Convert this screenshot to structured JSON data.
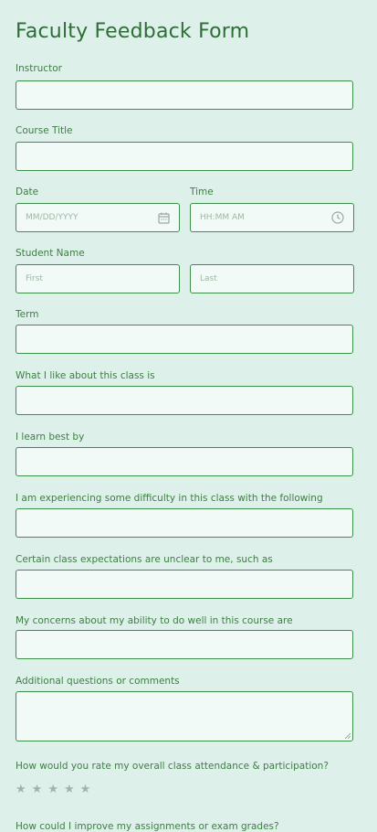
{
  "form": {
    "title": "Faculty Feedback Form",
    "instructor_label": "Instructor",
    "course_title_label": "Course Title",
    "date_label": "Date",
    "date_placeholder": "MM/DD/YYYY",
    "time_label": "Time",
    "time_placeholder": "HH:MM AM",
    "student_name_label": "Student Name",
    "first_placeholder": "First",
    "last_placeholder": "Last",
    "term_label": "Term",
    "like_label": "What I like about this class is",
    "learn_label": "I learn best by",
    "difficulty_label": "I am experiencing some difficulty in this class with the following",
    "expectations_label": "Certain class expectations are unclear to me, such as",
    "concerns_label": "My concerns about my ability to do well in this course are",
    "comments_label": "Additional questions or comments",
    "rating_label": "How would you rate my overall class attendance & participation?",
    "rating_value": 0,
    "rating_max": 5,
    "improve_label": "How could I improve my assignments or exam grades?"
  },
  "icons": {
    "date": "calendar-icon",
    "time": "clock-icon",
    "rating": "star-icon"
  },
  "colors": {
    "background": "#ddf1ea",
    "field_background": "#f1faf7",
    "field_border": "#3f8d4b",
    "text": "#2e6f37",
    "placeholder": "#9cb8a4",
    "star": "#a4b2ab"
  }
}
